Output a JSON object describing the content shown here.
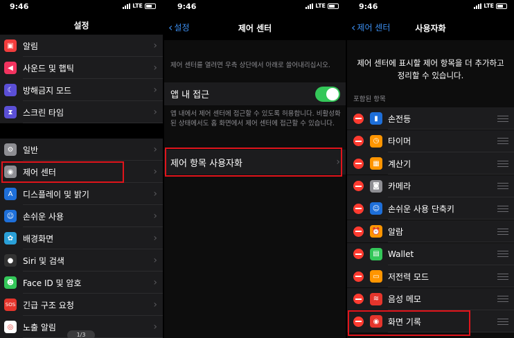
{
  "status": {
    "time": "9:46",
    "network": "LTE"
  },
  "left": {
    "title": "설정",
    "group1": [
      {
        "label": "알림",
        "icon": "notifications-icon",
        "color": "#f23d3d"
      },
      {
        "label": "사운드 및 햅틱",
        "icon": "sound-icon",
        "color": "#f2335f"
      },
      {
        "label": "방해금지 모드",
        "icon": "moon-icon",
        "color": "#5b4fd6"
      },
      {
        "label": "스크린 타임",
        "icon": "hourglass-icon",
        "color": "#5b4fd6"
      }
    ],
    "group2": [
      {
        "label": "일반",
        "icon": "gear-icon",
        "color": "#8e8e93"
      },
      {
        "label": "제어 센터",
        "icon": "toggles-icon",
        "color": "#8e8e93"
      },
      {
        "label": "디스플레이 및 밝기",
        "icon": "text-size-icon",
        "color": "#1e6fd9"
      },
      {
        "label": "손쉬운 사용",
        "icon": "accessibility-icon",
        "color": "#1e6fd9"
      },
      {
        "label": "배경화면",
        "icon": "flower-icon",
        "color": "#2aa0d8"
      },
      {
        "label": "Siri 및 검색",
        "icon": "siri-icon",
        "color": "#333333"
      },
      {
        "label": "Face ID 및 암호",
        "icon": "face-id-icon",
        "color": "#34c759"
      },
      {
        "label": "긴급 구조 요청",
        "icon": "sos-icon",
        "color": "#e5352c"
      },
      {
        "label": "노출 알림",
        "icon": "exposure-icon",
        "color": "#ffffff"
      }
    ],
    "pager": "1/3"
  },
  "middle": {
    "back": "설정",
    "title": "제어 센터",
    "intro": "제어 센터를 열려면 우측 상단에서 아래로 쓸어내리십시오.",
    "access_label": "앱 내 접근",
    "access_note": "앱 내에서 제어 센터에 접근할 수 있도록 허용합니다. 비활성화된 상태에서도 홈 화면에서 제어 센터에 접근할 수 있습니다.",
    "customize_label": "제어 항목 사용자화"
  },
  "right": {
    "back": "제어 센터",
    "title": "사용자화",
    "description": "제어 센터에 표시할 제어 항목을 더 추가하고 정리할 수 있습니다.",
    "section_header": "포함된 항목",
    "items": [
      {
        "label": "손전등",
        "icon": "flashlight-icon",
        "color": "#1e6fd9"
      },
      {
        "label": "타이머",
        "icon": "timer-icon",
        "color": "#ff9500"
      },
      {
        "label": "계산기",
        "icon": "calculator-icon",
        "color": "#ff9500"
      },
      {
        "label": "카메라",
        "icon": "camera-icon",
        "color": "#8e8e93"
      },
      {
        "label": "손쉬운 사용 단축키",
        "icon": "accessibility-icon",
        "color": "#1e6fd9"
      },
      {
        "label": "알람",
        "icon": "alarm-icon",
        "color": "#ff9500"
      },
      {
        "label": "Wallet",
        "icon": "wallet-icon",
        "color": "#34c759"
      },
      {
        "label": "저전력 모드",
        "icon": "battery-icon",
        "color": "#ff9500"
      },
      {
        "label": "음성 메모",
        "icon": "voice-memo-icon",
        "color": "#e5352c"
      },
      {
        "label": "화면 기록",
        "icon": "screen-record-icon",
        "color": "#e5352c"
      }
    ]
  }
}
